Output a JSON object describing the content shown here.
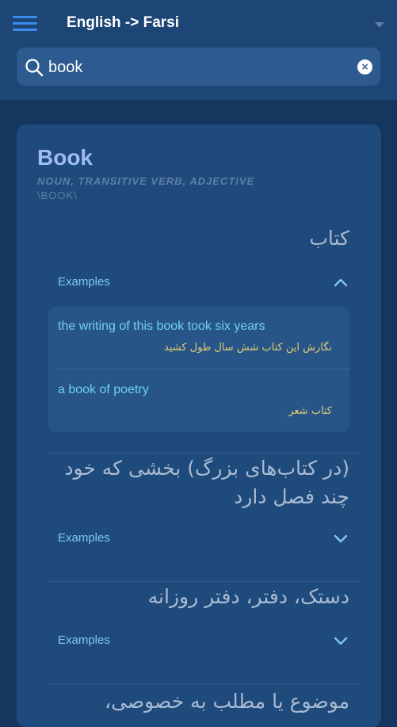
{
  "header": {
    "title": "English -> Farsi",
    "menu_icon": "hamburger-menu-icon",
    "dropdown_icon": "caret-down-icon"
  },
  "search": {
    "value": "book",
    "placeholder": "",
    "search_icon": "search-icon",
    "clear_icon": "clear-icon",
    "clear_glyph": "×"
  },
  "entry": {
    "headword": "Book",
    "parts_of_speech": "NOUN, TRANSITIVE VERB, ADJECTIVE",
    "pronunciation": "\\BOOK\\",
    "senses": [
      {
        "meaning": "کتاب",
        "examples_label": "Examples",
        "expanded": true,
        "examples": [
          {
            "en": "the writing of this book took six years",
            "fa": "نگارش این کتاب شش سال طول کشید"
          },
          {
            "en": "a book of poetry",
            "fa": "کتاب شعر"
          }
        ]
      },
      {
        "meaning_line1": "(در کتاب‌های بزرگ) بخشی که خود",
        "meaning_line2": "چند فصل دارد",
        "examples_label": "Examples",
        "expanded": false
      },
      {
        "meaning": "دستک، دفتر، دفتر روزانه",
        "examples_label": "Examples",
        "expanded": false
      },
      {
        "meaning": "موضوع یا مطلب به خصوصی،",
        "examples_label": "",
        "expanded": false
      }
    ]
  },
  "colors": {
    "background": "#15365f",
    "header": "#1d4575",
    "card": "#1f4a7c",
    "accent": "#3b8ef0",
    "headword": "#9fbdf2",
    "example_en": "#6fd0f5",
    "example_fa": "#e0cc73"
  }
}
